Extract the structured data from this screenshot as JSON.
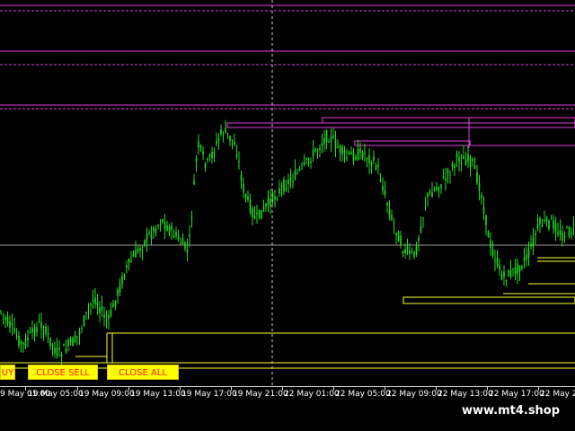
{
  "colors": {
    "background": "#000000",
    "candle": "#22dd22",
    "magenta": "#e040e0",
    "yellow": "#ffff30",
    "grid": "#9a9a9a",
    "button_bg": "#ffff00",
    "button_text": "#ff1a1a"
  },
  "buttons": {
    "buy": "UY",
    "close_sell": "CLOSE SELL",
    "close_all": "CLOSE ALL"
  },
  "time_axis": [
    "9 May 01:00",
    "19 May 05:00",
    "19 May 09:00",
    "19 May 13:00",
    "19 May 17:00",
    "19 May 21:00",
    "22 May 01:00",
    "22 May 05:00",
    "22 May 09:00",
    "22 May 13:00",
    "22 May 17:00",
    "22 May 21:"
  ],
  "brand": "www.mt4.shop"
}
